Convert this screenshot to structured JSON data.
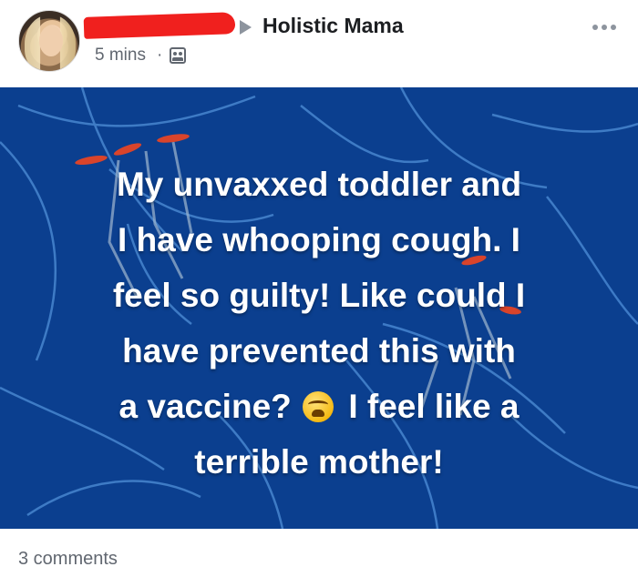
{
  "post": {
    "author_redacted": true,
    "group_name": "Holistic Mama",
    "timestamp": "5 mins",
    "separator": "·",
    "privacy_icon": "group-icon",
    "more_icon": "more-options-icon",
    "body_lines": [
      "My unvaxxed toddler and",
      "I have whooping cough. I",
      "feel so guilty! Like could I",
      "have prevented this with",
      "a vaccine?",
      "I feel like a",
      "terrible mother!"
    ],
    "emoji": "weary-face-emoji",
    "background_color": "#0b3f8f",
    "comments_count": "3 comments"
  }
}
